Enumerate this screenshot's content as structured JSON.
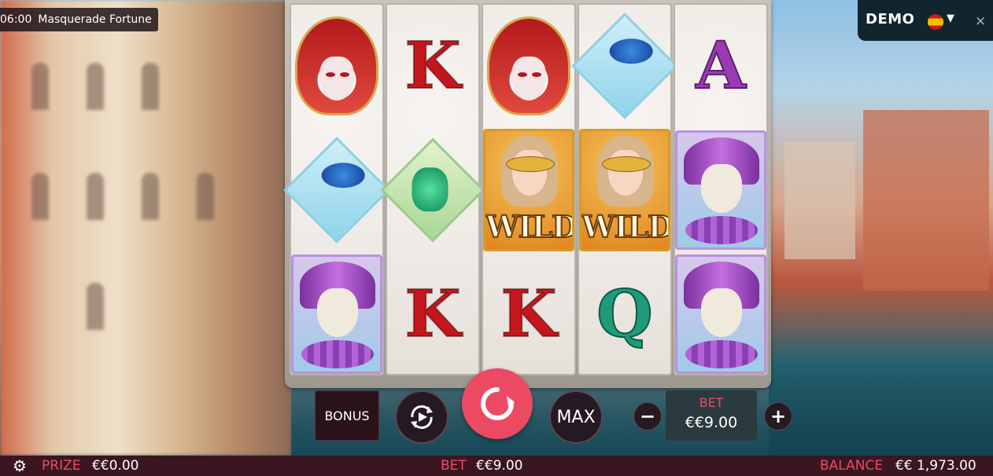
{
  "header": {
    "time": "06:00",
    "game_title": "Masquerade Fortune"
  },
  "top_right": {
    "mode": "DEMO",
    "language_flag": "spain-flag-icon",
    "caret": "▼",
    "close": "×"
  },
  "reels": [
    [
      "red-jester-mask",
      "blue-diamond-mask",
      "purple-jester"
    ],
    [
      "K",
      "green-beak-mask",
      "K"
    ],
    [
      "red-jester-mask",
      "WILD",
      "K"
    ],
    [
      "blue-diamond-mask",
      "WILD",
      "Q"
    ],
    [
      "A",
      "purple-jester",
      "purple-jester"
    ]
  ],
  "symbols": {
    "k": "K",
    "a": "A",
    "q": "Q",
    "wild": "WILD"
  },
  "controls": {
    "bonus_label": "BONUS",
    "max_label": "MAX",
    "minus": "−",
    "plus": "+",
    "bet_label": "BET",
    "bet_value": "€€9.00"
  },
  "bottom_bar": {
    "prize_label": "PRIZE",
    "prize_value": "€€0.00",
    "bet_label": "BET",
    "bet_value": "€€9.00",
    "balance_label": "BALANCE",
    "balance_value": "€€ 1,973.00"
  },
  "colors": {
    "accent": "#ec4a63",
    "bar_bg": "#3a1621",
    "demo_bg": "#12252f"
  }
}
